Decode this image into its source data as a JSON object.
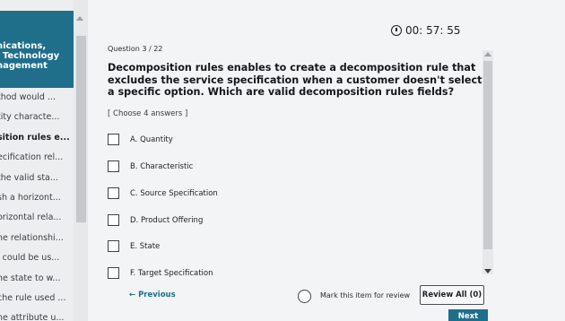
{
  "sidebar": {
    "header_lines": [
      "nications,",
      "l Technology",
      "nagement"
    ],
    "items": [
      {
        "label": "thod would ..."
      },
      {
        "label": "tity characte..."
      },
      {
        "label": "sition rules e...",
        "active": true
      },
      {
        "label": "ecification rel..."
      },
      {
        "label": "the valid sta..."
      },
      {
        "label": "sh a horizont..."
      },
      {
        "label": "orizontal rela..."
      },
      {
        "label": "ne relationshi..."
      },
      {
        "label": "l could be us..."
      },
      {
        "label": "he state to w..."
      },
      {
        "label": "che rule used ..."
      },
      {
        "label": "he attribute u..."
      }
    ]
  },
  "timer": {
    "value": "00: 57: 55",
    "icon": "clock-icon"
  },
  "question": {
    "number": "Question 3 / 22",
    "text": "Decomposition rules enables to create a decomposition rule that excludes the service specification when a customer doesn't select a specific option. Which are valid decomposition rules fields?",
    "instruction": "[ Choose 4 answers ]",
    "options": [
      {
        "label": "A. Quantity"
      },
      {
        "label": "B. Characteristic"
      },
      {
        "label": "C. Source Specification"
      },
      {
        "label": "D. Product Offering"
      },
      {
        "label": "E. State"
      },
      {
        "label": "F. Target Specification"
      }
    ]
  },
  "footer": {
    "back_label": "← Previous",
    "review_label": "Mark this item for review",
    "review_all_label": "Review All (0)",
    "next_label": "Next"
  },
  "colors": {
    "accent": "#1f6f8b"
  }
}
